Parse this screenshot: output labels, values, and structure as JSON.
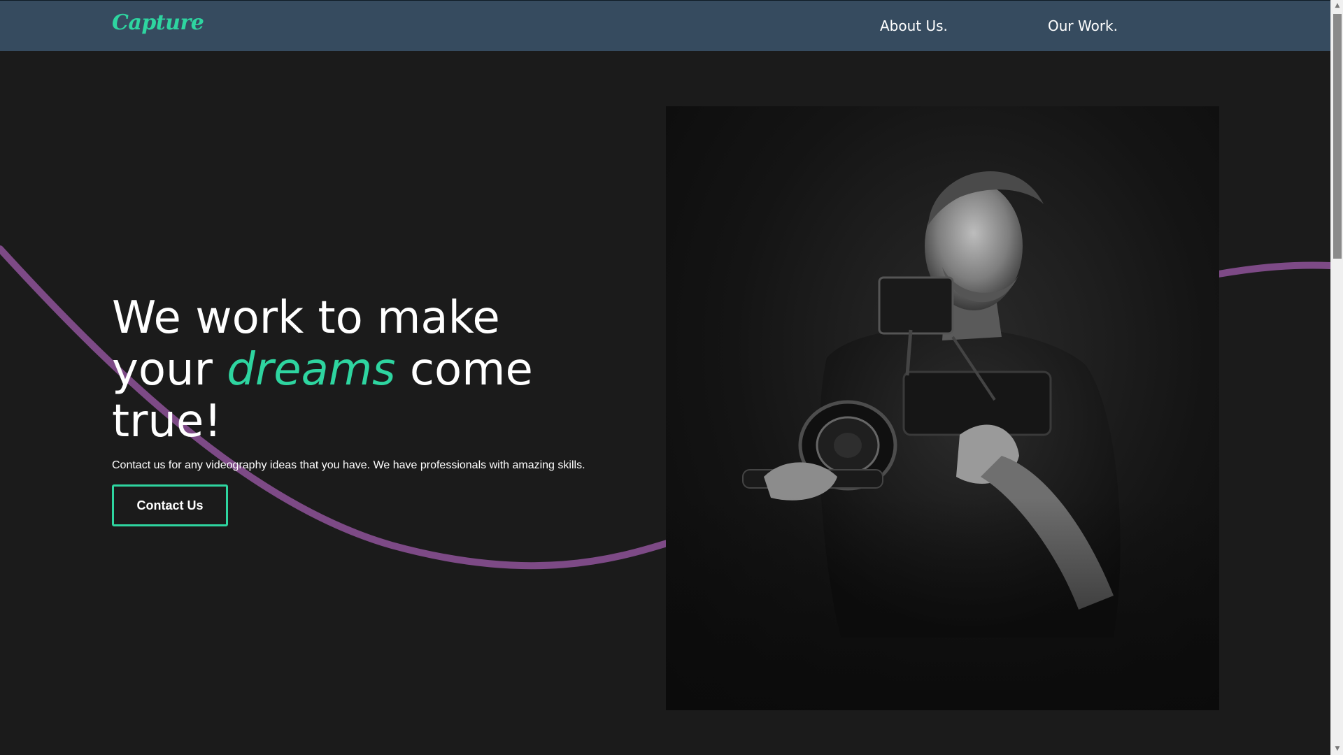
{
  "nav": {
    "logo": "Capture",
    "links": [
      "About Us.",
      "Our Work."
    ]
  },
  "hero": {
    "title_line1": "We work to make",
    "title_your": "your",
    "title_accent": "dreams",
    "title_come": "come",
    "title_line3": "true!",
    "description": "Contact us for any videography ideas that you have. We have professionals with amazing skills.",
    "button_label": "Contact Us"
  },
  "colors": {
    "nav_bg": "#364b5f",
    "page_bg": "#1b1b1b",
    "accent": "#2ed5a0",
    "wave": "#7d4a86"
  },
  "icons": {
    "scroll_up": "chevron-up-icon",
    "scroll_down": "chevron-down-icon"
  }
}
